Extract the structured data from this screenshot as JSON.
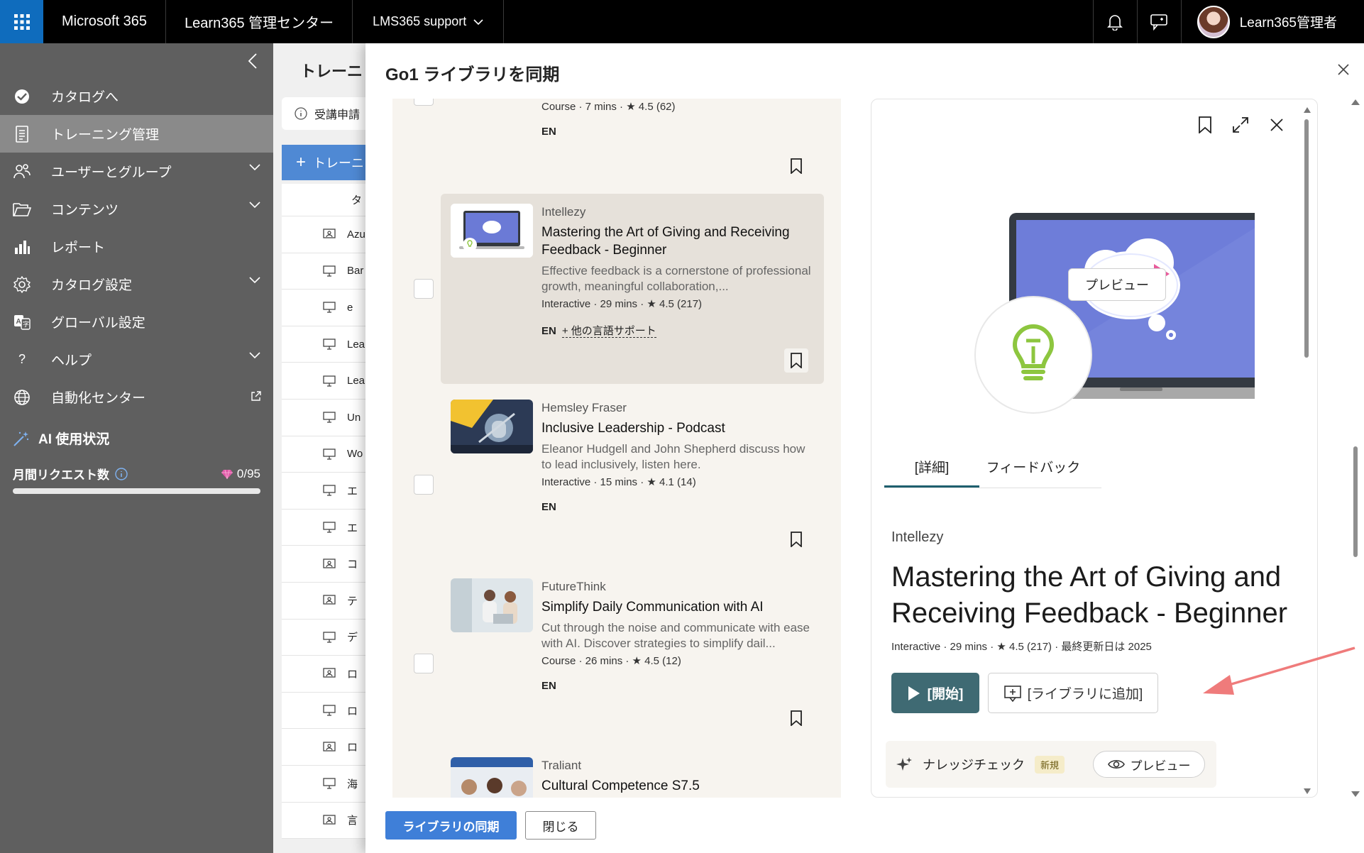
{
  "topbar": {
    "brand": "Microsoft 365",
    "app_name": "Learn365 管理センター",
    "tenant": "LMS365 support",
    "user_name": "Learn365管理者"
  },
  "nav": {
    "items": [
      {
        "label": "カタログへ",
        "icon": "checkmark-circle-icon",
        "expandable": false
      },
      {
        "label": "トレーニング管理",
        "icon": "document-list-icon",
        "expandable": false,
        "active": true
      },
      {
        "label": "ユーザーとグループ",
        "icon": "people-icon",
        "expandable": true
      },
      {
        "label": "コンテンツ",
        "icon": "folder-open-icon",
        "expandable": true
      },
      {
        "label": "レポート",
        "icon": "bar-chart-icon",
        "expandable": false
      },
      {
        "label": "カタログ設定",
        "icon": "gear-icon",
        "expandable": true
      },
      {
        "label": "グローバル設定",
        "icon": "translate-icon",
        "expandable": false
      },
      {
        "label": "ヘルプ",
        "icon": "question-icon",
        "expandable": true
      },
      {
        "label": "自動化センター",
        "icon": "globe-icon",
        "expandable": false,
        "external": true
      }
    ],
    "ai_usage_label": "AI 使用状況",
    "monthly_requests_label": "月間リクエスト数",
    "monthly_requests_value": "0/95",
    "monthly_requests_fraction": 0
  },
  "background_page": {
    "title": "トレーニ",
    "info_text": "受講申請",
    "add_button": "トレーニ",
    "header_cell": "タ",
    "rows": [
      "Azu",
      "Bar",
      "e",
      "Lea",
      "Lea",
      "Un",
      "Wo",
      "エ",
      "エ",
      "コ",
      "テ",
      "デ",
      "ロ",
      "ロ",
      "ロ",
      "海",
      "言"
    ]
  },
  "dialog": {
    "title": "Go1 ライブラリを同期",
    "list": {
      "top_partial": {
        "stats": "Course · 7 mins · ★ 4.5 (62)",
        "lang": "EN"
      },
      "cards": [
        {
          "provider": "Intellezy",
          "title": "Mastering the Art of Giving and Receiving Feedback - Beginner",
          "description": "Effective feedback is a cornerstone of professional growth, meaningful collaboration,...",
          "stats": "Interactive · 29 mins · ★ 4.5 (217)",
          "lang": "EN",
          "more_lang": "+ 他の言語サポート",
          "selected": true
        },
        {
          "provider": "Hemsley Fraser",
          "title": "Inclusive Leadership - Podcast",
          "description": "Eleanor Hudgell and John Shepherd discuss how to lead inclusively, listen here.",
          "stats": "Interactive · 15 mins · ★ 4.1 (14)",
          "lang": "EN"
        },
        {
          "provider": "FutureThink",
          "title": "Simplify Daily Communication with AI",
          "description": "Cut through the noise and communicate with ease with AI. Discover strategies to simplify dail...",
          "stats": "Course · 26 mins · ★ 4.5 (12)",
          "lang": "EN"
        },
        {
          "provider": "Traliant",
          "title": "Cultural Competence S7.5"
        }
      ]
    },
    "detail": {
      "preview_bubble": "プレビュー",
      "tabs": [
        "[詳細]",
        "フィードバック"
      ],
      "provider": "Intellezy",
      "title": "Mastering the Art of Giving and Receiving Feedback - Beginner",
      "stats": "Interactive · 29 mins · ★ 4.5 (217) · 最終更新日は 2025",
      "start_button": "[開始]",
      "add_button": "[ライブラリに追加]",
      "knowledge_check": "ナレッジチェック",
      "new_badge": "新規",
      "preview_button": "プレビュー"
    },
    "footer": {
      "sync_button": "ライブラリの同期",
      "close_button": "閉じる"
    }
  }
}
